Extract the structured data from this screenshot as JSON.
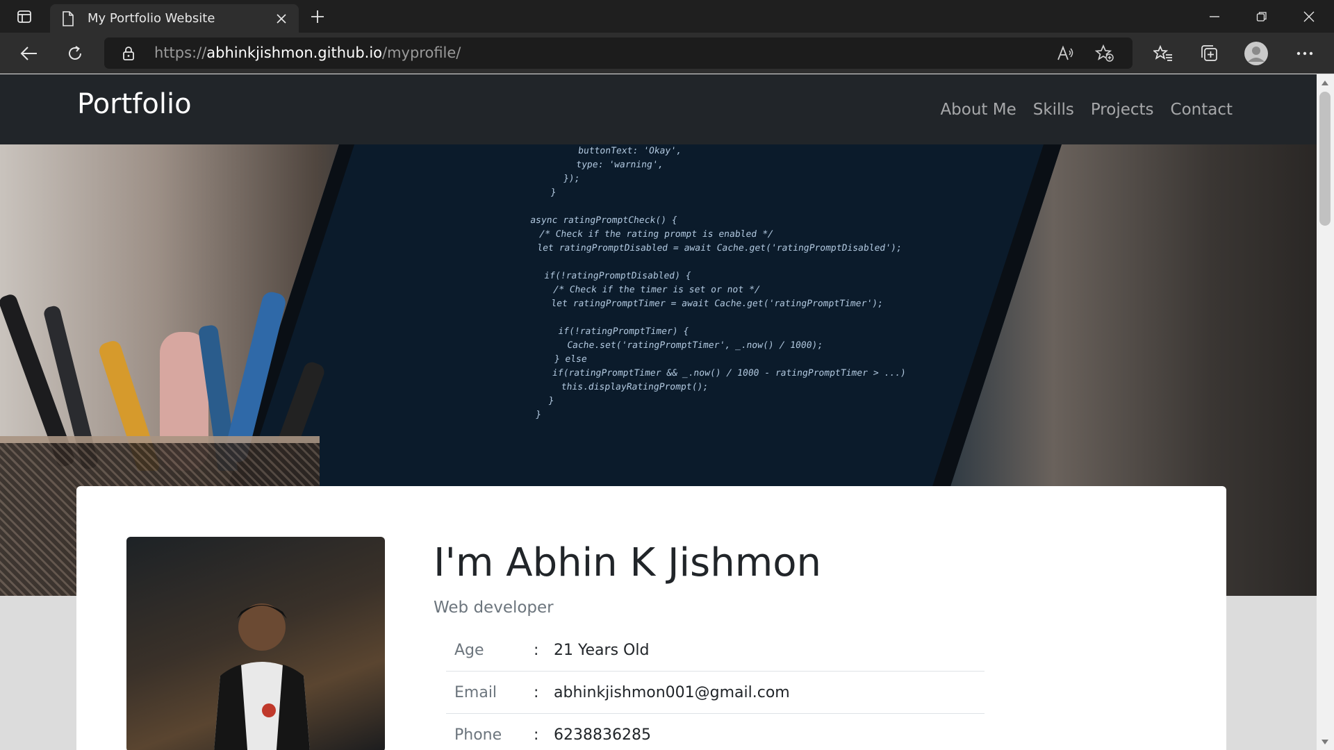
{
  "browser": {
    "tab_title": "My Portfolio Website",
    "url_prefix": "https://",
    "url_host": "abhinkjishmon.github.io",
    "url_path": "/myprofile/"
  },
  "site": {
    "brand": "Portfolio",
    "nav": [
      "About Me",
      "Skills",
      "Projects",
      "Contact"
    ]
  },
  "profile": {
    "name": "I'm Abhin K Jishmon",
    "role": "Web developer",
    "separator": ":",
    "details": [
      {
        "label": "Age",
        "value": "21 Years Old"
      },
      {
        "label": "Email",
        "value": "abhinkjishmon001@gmail.com"
      },
      {
        "label": "Phone",
        "value": "6238836285"
      }
    ]
  },
  "colors": {
    "navbar": "#212529",
    "card": "#ffffff",
    "page_bg": "#dcdcdc"
  }
}
